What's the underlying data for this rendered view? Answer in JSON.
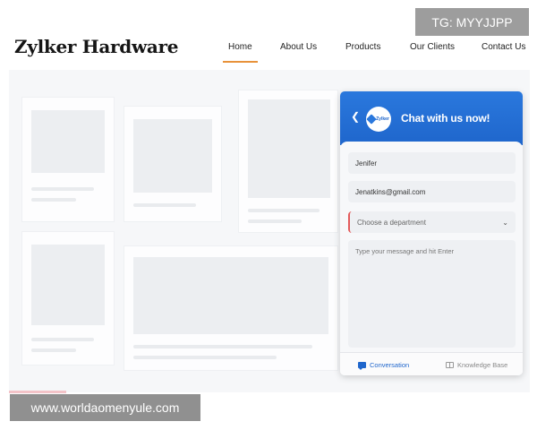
{
  "header": {
    "brand": "Zylker Hardware",
    "nav": [
      {
        "label": "Home",
        "active": true
      },
      {
        "label": "About Us",
        "active": false
      },
      {
        "label": "Products",
        "active": false
      },
      {
        "label": "Our Clients",
        "active": false
      },
      {
        "label": "Contact Us",
        "active": false
      }
    ]
  },
  "chat": {
    "logo_text": "Zylker",
    "title": "Chat with us now!",
    "name_value": "Jenifer",
    "email_value": "Jenatkins@gmail.com",
    "department_placeholder": "Choose a department",
    "message_placeholder": "Type your message and hit Enter",
    "tabs": {
      "conversation": "Conversation",
      "knowledge_base": "Knowledge Base"
    }
  },
  "watermarks": {
    "top": "TG: MYYJJPP",
    "bottom": "www.worldaomenyule.com"
  },
  "colors": {
    "accent": "#e8923a",
    "chat_header": "#1f66cc",
    "required_marker": "#e35b5b"
  }
}
